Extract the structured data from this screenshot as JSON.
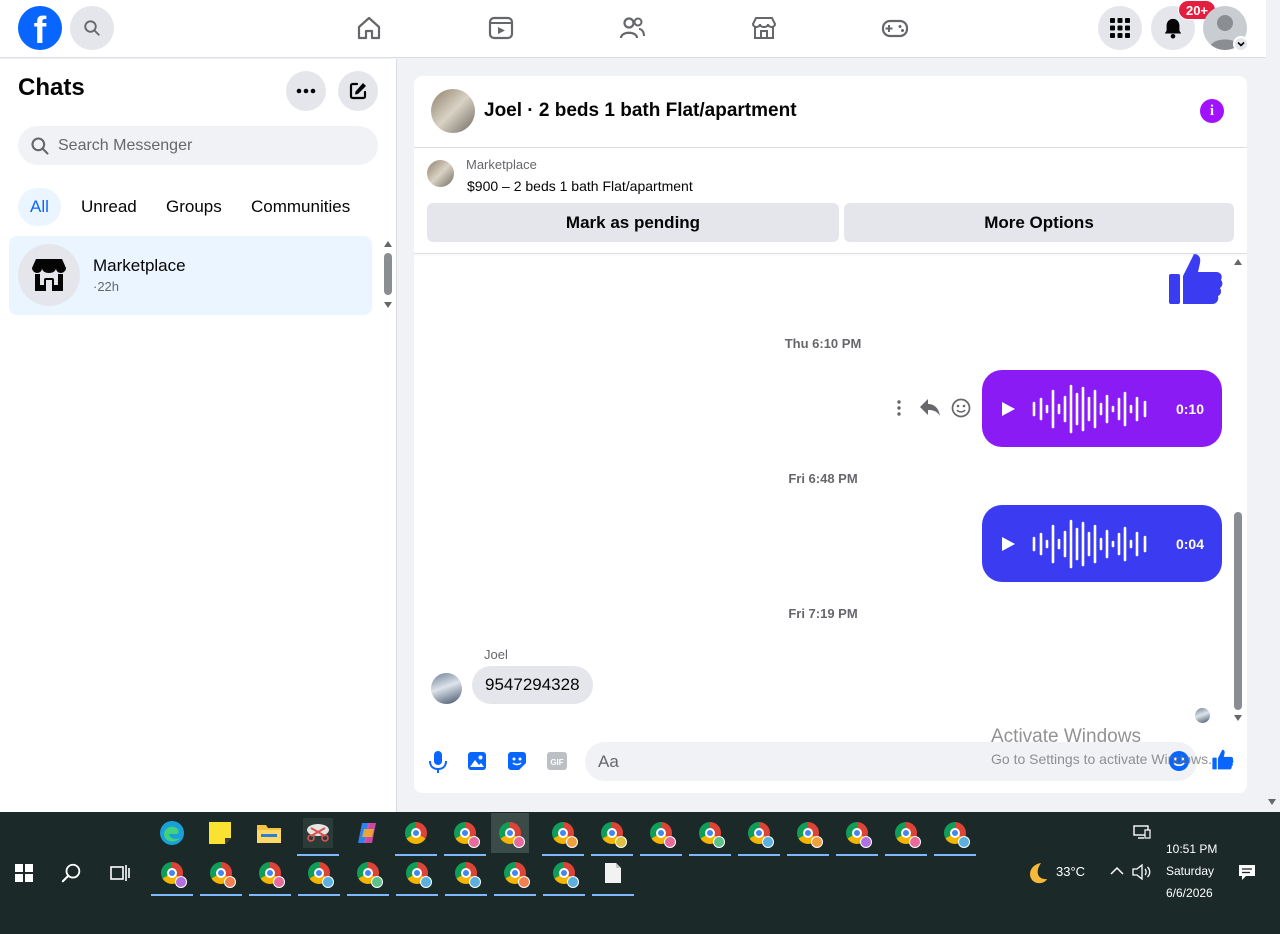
{
  "nav": {
    "logo_letter": "f",
    "notifications_badge": "20+",
    "icons": [
      "facebook-logo",
      "search-icon",
      "home-icon",
      "video-icon",
      "friends-icon",
      "marketplace-icon",
      "gaming-icon",
      "menu-grid-icon",
      "bell-icon",
      "profile-avatar"
    ]
  },
  "left": {
    "title": "Chats",
    "search_placeholder": "Search Messenger",
    "filters": [
      "All",
      "Unread",
      "Groups",
      "Communities"
    ],
    "active_filter": "All",
    "chats": [
      {
        "name": "Marketplace",
        "time": "·22h"
      }
    ]
  },
  "conversation": {
    "title": "Joel · 2 beds 1 bath Flat/apartment",
    "marketplace_label": "Marketplace",
    "listing": "$900 – 2 beds 1 bath Flat/apartment",
    "mark_pending": "Mark as pending",
    "more_options": "More Options",
    "messages": [
      {
        "timestamp": "Thu 6:10 PM",
        "type": "voice",
        "duration": "0:10",
        "color": "#8a1bf5"
      },
      {
        "timestamp": "Fri 6:48 PM",
        "type": "voice",
        "duration": "0:04",
        "color": "#3b3cf2"
      },
      {
        "timestamp": "Fri 7:19 PM",
        "sender": "Joel",
        "text": "9547294328"
      }
    ],
    "composer_placeholder": "Aa"
  },
  "watermark": {
    "line1": "Activate Windows",
    "line2": "Go to Settings to activate Windows."
  },
  "taskbar": {
    "temperature": "33°C",
    "time": "10:51 PM",
    "day": "Saturday",
    "date": "6/6/2026"
  },
  "colors": {
    "facebook_blue": "#0866ff",
    "voice_purple": "#8a1bf5",
    "voice_blue": "#3b3cf2",
    "info_purple": "#a112ff",
    "taskbar_bg": "#1b2a28"
  }
}
